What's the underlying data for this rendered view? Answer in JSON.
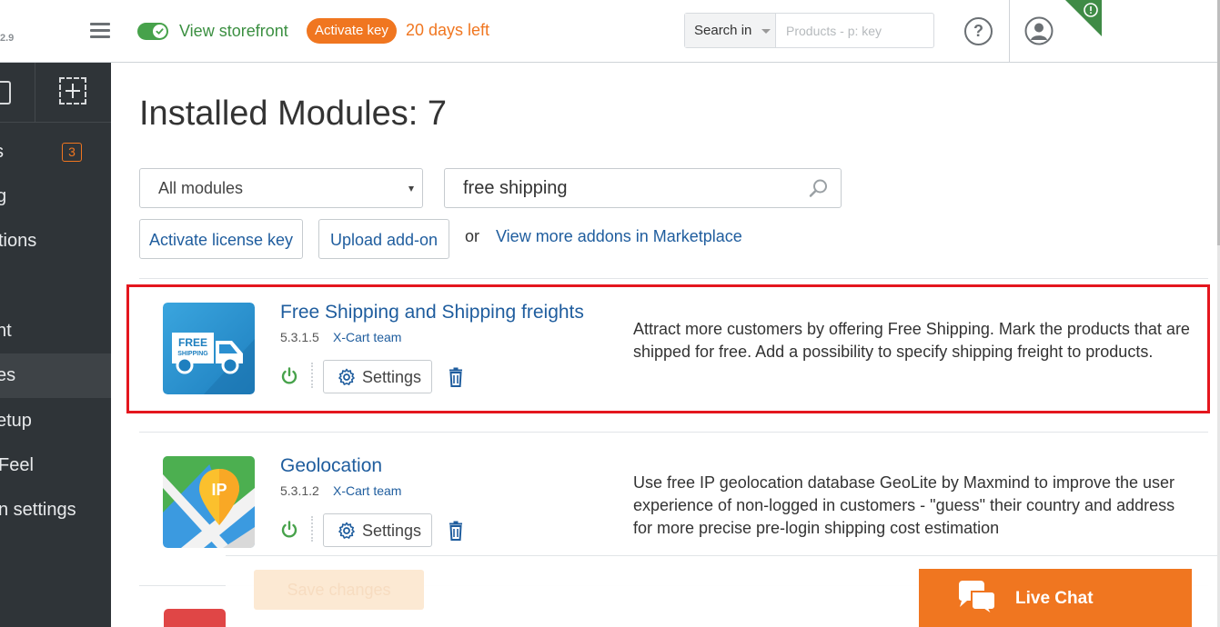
{
  "header": {
    "version": "2.9",
    "view_storefront": "View storefront",
    "activate_key": "Activate key",
    "days_left": "20 days left",
    "search_in_label": "Search in",
    "search_placeholder": "Products - p: key",
    "help": "?"
  },
  "sidebar": {
    "badge_count": "3",
    "items": [
      {
        "label": "s"
      },
      {
        "label": "g"
      },
      {
        "label": "tions"
      },
      {
        "label": ""
      },
      {
        "label": "nt"
      },
      {
        "label": "es"
      },
      {
        "label": "etup"
      },
      {
        "label": " Feel"
      },
      {
        "label": "n settings"
      }
    ]
  },
  "main": {
    "title": "Installed Modules: 7",
    "filter_value": "All modules",
    "search_value": "free shipping",
    "activate_license": "Activate license key",
    "upload_addon": "Upload add-on",
    "or_text": "or",
    "marketplace_link": "View more addons in Marketplace"
  },
  "modules": [
    {
      "name": "Free Shipping and Shipping freights",
      "version": "5.3.1.5",
      "author": "X-Cart team",
      "settings_label": "Settings",
      "description": "Attract more customers by offering Free Shipping. Mark the products that are shipped for free. Add a possibility to specify shipping freight to products.",
      "icon_text_1": "FREE",
      "icon_text_2": "SHIPPING"
    },
    {
      "name": "Geolocation",
      "version": "5.3.1.2",
      "author": "X-Cart team",
      "settings_label": "Settings",
      "description": "Use free IP geolocation database GeoLite by Maxmind to improve the user experience of non-logged in customers - \"guess\" their country and address for more precise pre-login shipping cost estimation",
      "icon_text_1": "IP"
    }
  ],
  "footer": {
    "save_changes": "Save changes",
    "live_chat": "Live Chat"
  },
  "colors": {
    "accent_orange": "#f07620",
    "link_blue": "#1f5d9e",
    "success_green": "#47a24b",
    "highlight_red": "#e4161e",
    "sidebar_bg": "#2f3438"
  }
}
